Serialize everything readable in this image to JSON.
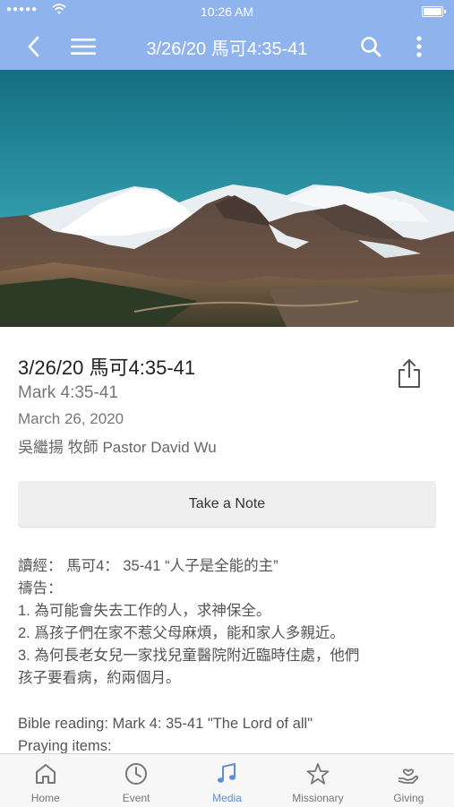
{
  "status_bar": {
    "signal": "●●●●●",
    "time": "10:26 AM"
  },
  "header": {
    "title": "3/26/20 馬可4:35-41",
    "back_icon": "chevron-left-icon",
    "menu_icon": "hamburger-menu-icon",
    "search_icon": "search-icon",
    "more_icon": "more-vertical-icon",
    "background_color": "#8fb3ec"
  },
  "sermon": {
    "title": "3/26/20 馬可4:35-41",
    "subtitle": "Mark 4:35-41",
    "date": "March 26, 2020",
    "speaker": "吳繼揚 牧師 Pastor David Wu",
    "share_icon": "share-icon"
  },
  "note_button": {
    "label": "Take a Note"
  },
  "notes": {
    "lines": [
      "讀經：  馬可4：  35-41 “人子是全能的主”",
      "禱告：",
      "1. 為可能會失去工作的人，求神保全。",
      "2. 爲孩子們在家不惹父母麻煩，能和家人多親近。",
      "3. 為何長老女兒一家找兒童醫院附近臨時住處，他們",
      "孩子要看病，約兩個月。"
    ],
    "english_lines": [
      "Bible reading: Mark 4: 35-41 \"The Lord of all\"",
      "Praying items:"
    ]
  },
  "tab_bar": {
    "active_color": "#5b8fd8",
    "tabs": [
      {
        "label": "Home",
        "icon": "home-icon"
      },
      {
        "label": "Event",
        "icon": "clock-icon"
      },
      {
        "label": "Media",
        "icon": "music-note-icon"
      },
      {
        "label": "Missionary",
        "icon": "star-icon"
      },
      {
        "label": "Giving",
        "icon": "giving-hand-icon"
      }
    ]
  }
}
